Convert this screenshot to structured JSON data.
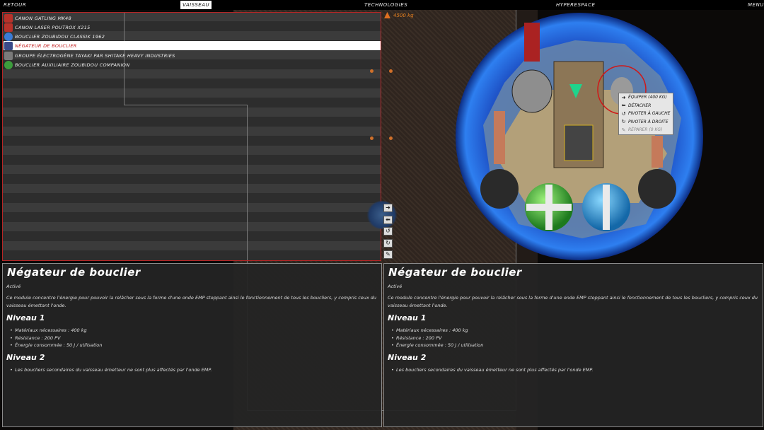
{
  "topbar": {
    "back": "Retour",
    "ship": "Vaisseau",
    "technologies": "Technologies",
    "hyperspace": "Hyperespace",
    "menu": "Menu"
  },
  "modules": [
    {
      "label": "Canon Gatling MK48",
      "icon": "gatling-cannon-icon",
      "color": "#c0392b"
    },
    {
      "label": "Canon laser Poutrox X215",
      "icon": "laser-cannon-icon",
      "color": "#c0392b"
    },
    {
      "label": "Bouclier Zoubidou Classik 1962",
      "icon": "shield-icon",
      "color": "#3a7bd5"
    },
    {
      "label": "Négateur de bouclier",
      "icon": "shield-negator-icon",
      "color": "#3a4a8a"
    },
    {
      "label": "Groupe électrogène Tayaki par Shitake Heavy Industries",
      "icon": "generator-icon",
      "color": "#777777"
    },
    {
      "label": "Bouclier auxiliaire Zoubidou Companion",
      "icon": "aux-shield-icon",
      "color": "#3c9c3c"
    }
  ],
  "selected_index": 3,
  "weight": "4500 kg",
  "context_menu": [
    {
      "label": "Équiper (400 kg)",
      "icon": "arrow-right-icon",
      "glyph": "➜",
      "enabled": true
    },
    {
      "label": "Détacher",
      "icon": "arrow-left-icon",
      "glyph": "⬅",
      "enabled": true
    },
    {
      "label": "Pivoter à gauche",
      "icon": "rotate-left-icon",
      "glyph": "↺",
      "enabled": true
    },
    {
      "label": "Pivoter à droite",
      "icon": "rotate-right-icon",
      "glyph": "↻",
      "enabled": true
    },
    {
      "label": "Réparer (0 kg)",
      "icon": "wrench-icon",
      "glyph": "✎",
      "enabled": false
    }
  ],
  "panel": {
    "title": "Négateur de bouclier",
    "status": "Activé",
    "description": "Ce module concentre l'énergie pour pouvoir la relâcher sous la forme d'une onde EMP stoppant ainsi le fonctionnement de tous les boucliers, y compris ceux du vaisseau émettant l'onde.",
    "level1_title": "Niveau 1",
    "level1_items": [
      "Matériaux nécessaires : 400 kg",
      "Résistance : 200 PV",
      "Énergie consommée : 50 J / utilisation"
    ],
    "level2_title": "Niveau 2",
    "level2_items": [
      "Les boucliers secondaires du vaisseau émetteur ne sont plus affectés par l'onde EMP."
    ]
  }
}
